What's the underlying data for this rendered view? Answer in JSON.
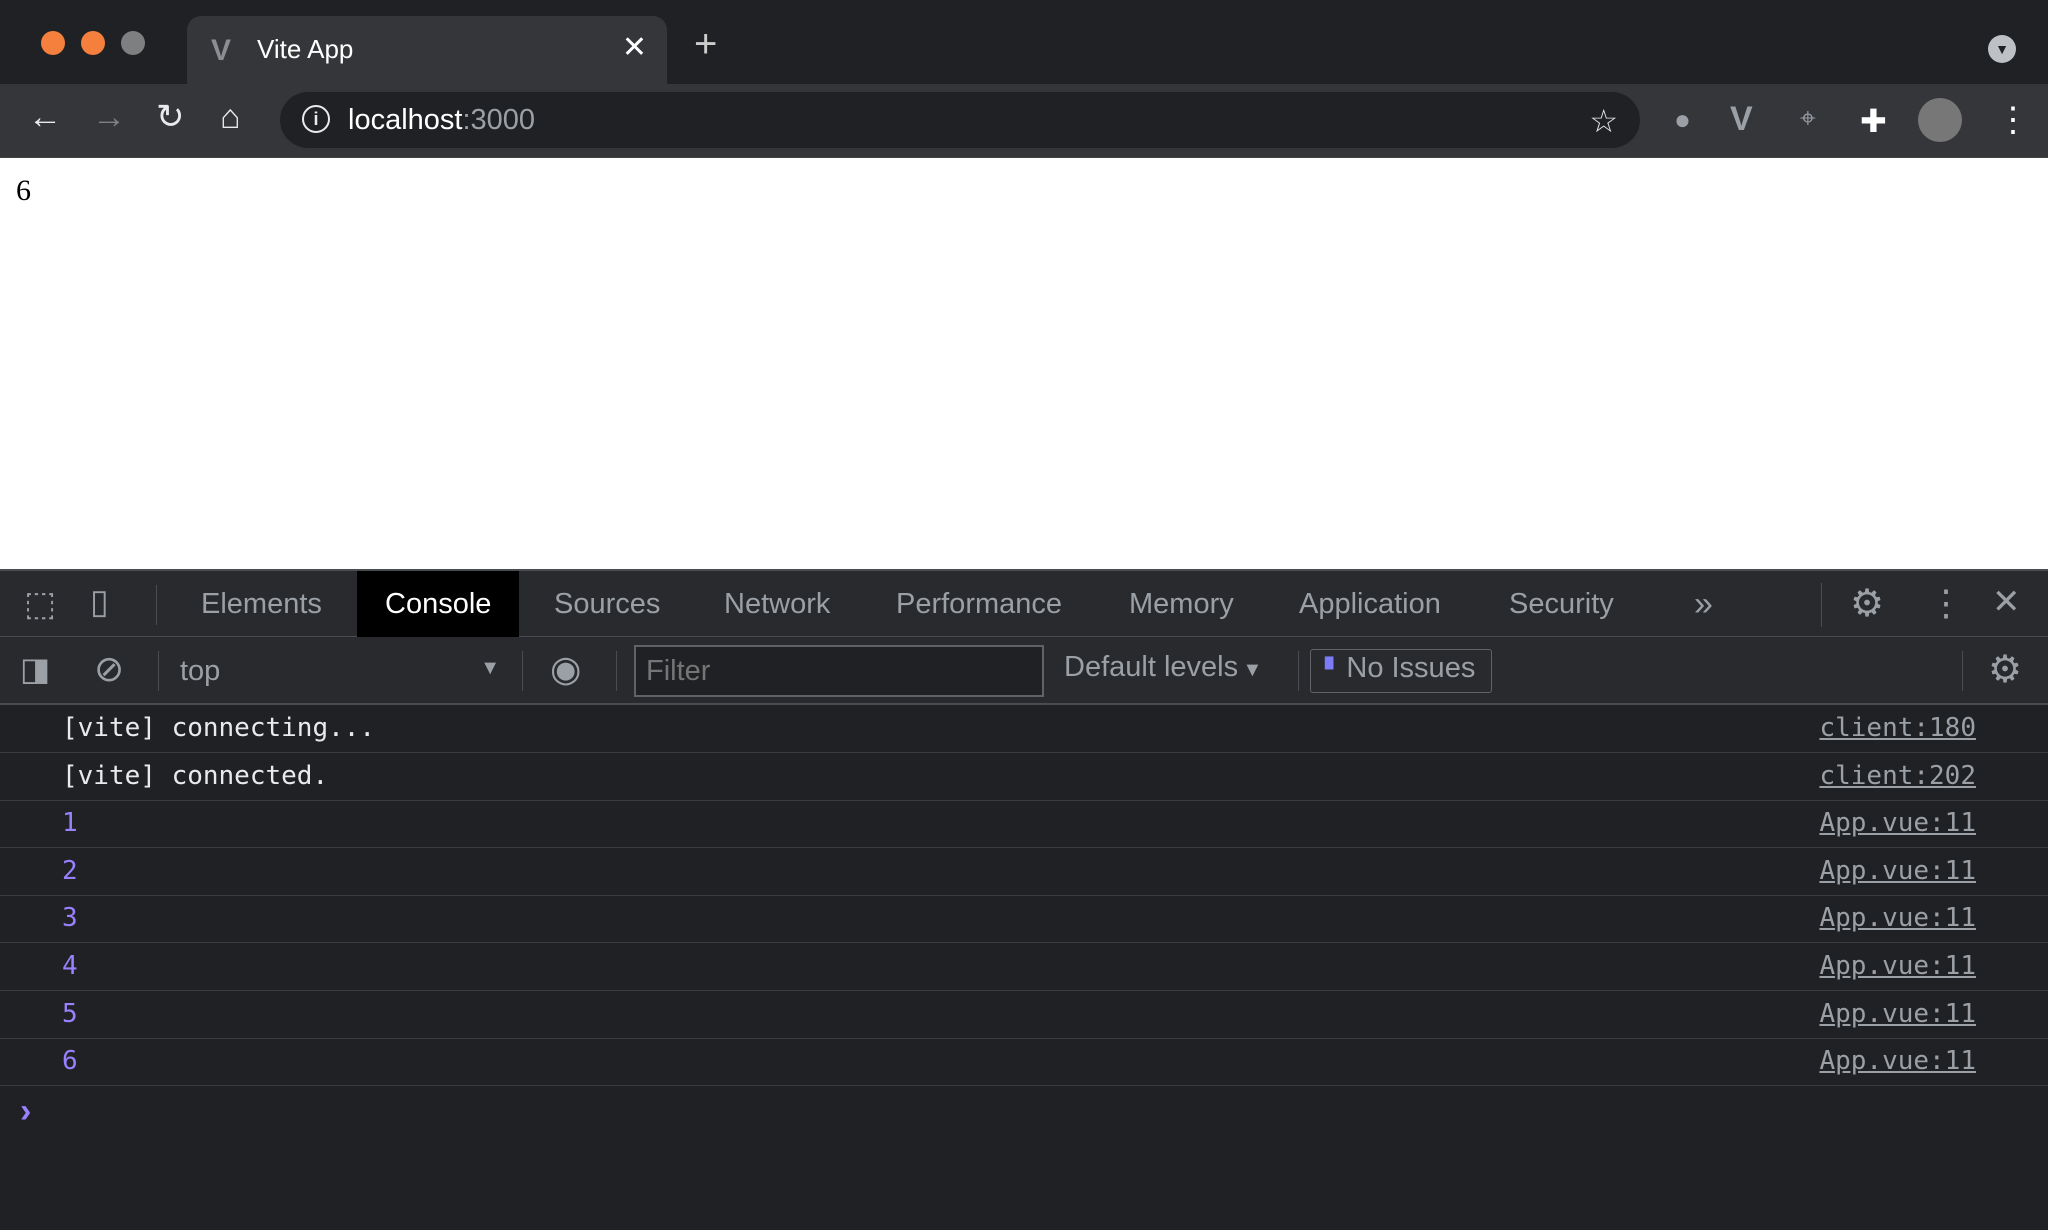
{
  "browser": {
    "tab_title": "Vite App",
    "url_host": "localhost",
    "url_port": ":3000",
    "colors": {
      "close": "#ff5f57",
      "minimize": "#febc2e",
      "zoom": "#8a8a8a"
    }
  },
  "page": {
    "content": "6"
  },
  "devtools": {
    "tabs": [
      "Elements",
      "Console",
      "Sources",
      "Network",
      "Performance",
      "Memory",
      "Application",
      "Security"
    ],
    "active_tab": "Console",
    "more_tabs": "»",
    "context": "top",
    "filter_placeholder": "Filter",
    "levels": "Default levels",
    "issues": "No Issues",
    "logs": [
      {
        "message": "[vite] connecting...",
        "source": "client:180",
        "type": "text"
      },
      {
        "message": "[vite] connected.",
        "source": "client:202",
        "type": "text"
      },
      {
        "message": "1",
        "source": "App.vue:11",
        "type": "number"
      },
      {
        "message": "2",
        "source": "App.vue:11",
        "type": "number"
      },
      {
        "message": "3",
        "source": "App.vue:11",
        "type": "number"
      },
      {
        "message": "4",
        "source": "App.vue:11",
        "type": "number"
      },
      {
        "message": "5",
        "source": "App.vue:11",
        "type": "number"
      },
      {
        "message": "6",
        "source": "App.vue:11",
        "type": "number"
      }
    ],
    "prompt": "›"
  }
}
